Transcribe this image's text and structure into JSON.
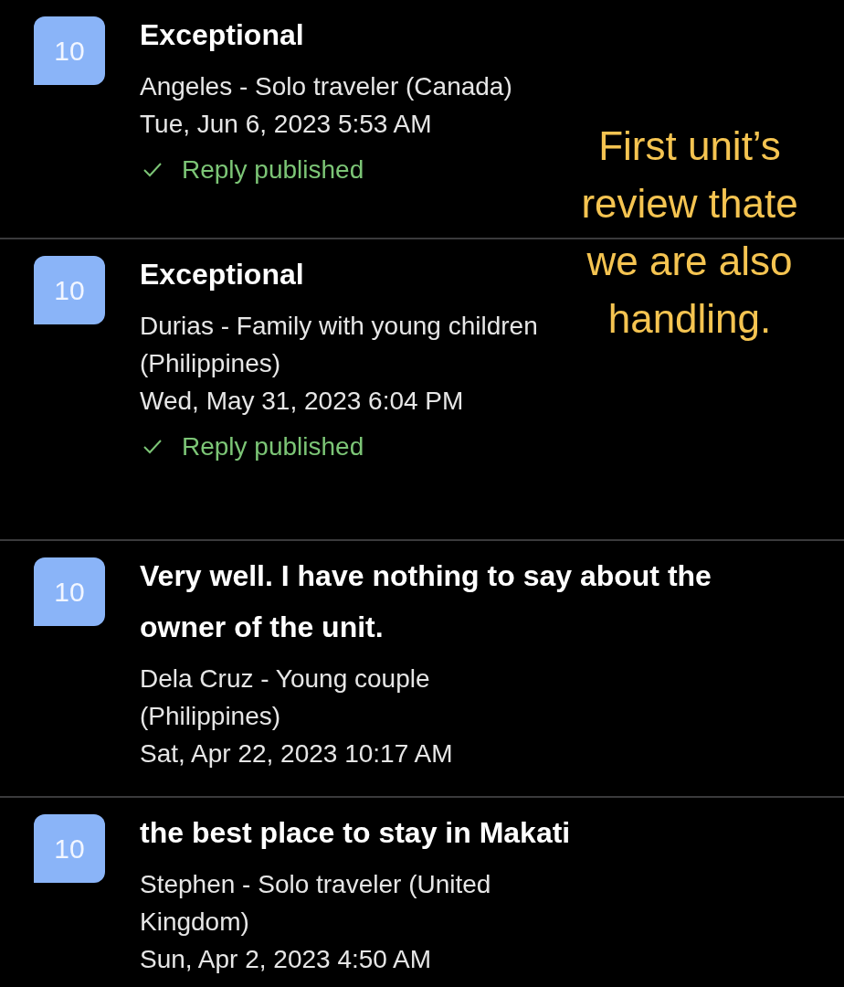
{
  "reviews": [
    {
      "score": "10",
      "title": "Exceptional",
      "reviewer": "Angeles - Solo traveler (Canada)",
      "date": "Tue, Jun 6, 2023 5:53 AM",
      "reply_published": true,
      "reply_label": "Reply published"
    },
    {
      "score": "10",
      "title": "Exceptional",
      "reviewer": "Durias - Family with young children (Philippines)",
      "date": "Wed, May 31, 2023 6:04 PM",
      "reply_published": true,
      "reply_label": "Reply published"
    },
    {
      "score": "10",
      "title": "Very well. I have nothing to say about the owner of the unit.",
      "reviewer": "Dela Cruz - Young couple (Philippines)",
      "date": "Sat, Apr 22, 2023 10:17 AM",
      "reply_published": false
    },
    {
      "score": "10",
      "title": "the best place to stay in Makati",
      "reviewer": "Stephen - Solo traveler (United Kingdom)",
      "date": "Sun, Apr 2, 2023 4:50 AM",
      "reply_published": false
    }
  ],
  "annotation": "First unit’s review thate we are also handling."
}
